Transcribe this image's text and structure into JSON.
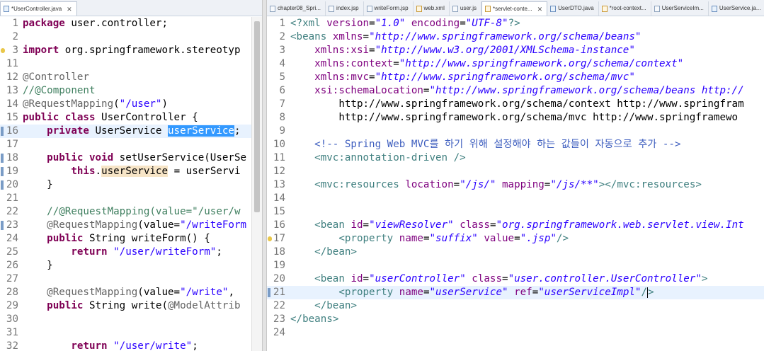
{
  "left_editor": {
    "tab": "*UserController.java",
    "lines": [
      {
        "n": "1",
        "t": "package user.controller;"
      },
      {
        "n": "2",
        "t": ""
      },
      {
        "n": "3",
        "t": "import org.springframework.stereotyp"
      },
      {
        "n": "11",
        "t": ""
      },
      {
        "n": "12",
        "t": "@Controller"
      },
      {
        "n": "13",
        "t": "//@Component"
      },
      {
        "n": "14",
        "t": "@RequestMapping(\"/user\")"
      },
      {
        "n": "15",
        "t": "public class UserController {"
      },
      {
        "n": "16",
        "t": "    private UserService userService;"
      },
      {
        "n": "17",
        "t": ""
      },
      {
        "n": "18",
        "t": "    public void setUserService(UserSe"
      },
      {
        "n": "19",
        "t": "        this.userService = userServi"
      },
      {
        "n": "20",
        "t": "    }"
      },
      {
        "n": "21",
        "t": ""
      },
      {
        "n": "22",
        "t": "    //@RequestMapping(value=\"/user/w"
      },
      {
        "n": "23",
        "t": "    @RequestMapping(value=\"/writeForm"
      },
      {
        "n": "24",
        "t": "    public String writeForm() {"
      },
      {
        "n": "25",
        "t": "        return \"/user/writeForm\";"
      },
      {
        "n": "26",
        "t": "    }"
      },
      {
        "n": "27",
        "t": ""
      },
      {
        "n": "28",
        "t": "    @RequestMapping(value=\"/write\", "
      },
      {
        "n": "29",
        "t": "    public String write(@ModelAttrib"
      },
      {
        "n": "30",
        "t": ""
      },
      {
        "n": "31",
        "t": ""
      },
      {
        "n": "32",
        "t": "        return \"/user/write\";"
      }
    ]
  },
  "right_editor": {
    "tabs": [
      {
        "label": "chapter08_Spri..."
      },
      {
        "label": "index.jsp"
      },
      {
        "label": "writeForm.jsp"
      },
      {
        "label": "web.xml"
      },
      {
        "label": "user.js"
      },
      {
        "label": "*servlet-conte..."
      },
      {
        "label": "UserDTO.java"
      },
      {
        "label": "*root-context..."
      },
      {
        "label": "UserServiceIm..."
      },
      {
        "label": "UserService.ja..."
      }
    ],
    "lines": [
      {
        "n": "1",
        "t": "<?xml version=\"1.0\" encoding=\"UTF-8\"?>"
      },
      {
        "n": "2",
        "t": "<beans xmlns=\"http://www.springframework.org/schema/beans\""
      },
      {
        "n": "3",
        "t": "    xmlns:xsi=\"http://www.w3.org/2001/XMLSchema-instance\""
      },
      {
        "n": "4",
        "t": "    xmlns:context=\"http://www.springframework.org/schema/context\""
      },
      {
        "n": "5",
        "t": "    xmlns:mvc=\"http://www.springframework.org/schema/mvc\""
      },
      {
        "n": "6",
        "t": "    xsi:schemaLocation=\"http://www.springframework.org/schema/beans http://"
      },
      {
        "n": "7",
        "t": "        http://www.springframework.org/schema/context http://www.springfram"
      },
      {
        "n": "8",
        "t": "        http://www.springframework.org/schema/mvc http://www.springframewo"
      },
      {
        "n": "9",
        "t": ""
      },
      {
        "n": "10",
        "t": "    <!-- Spring Web MVC를 하기 위해 설정해야 하는 값들이 자동으로 추가 -->"
      },
      {
        "n": "11",
        "t": "    <mvc:annotation-driven />"
      },
      {
        "n": "12",
        "t": ""
      },
      {
        "n": "13",
        "t": "    <mvc:resources location=\"/js/\" mapping=\"/js/**\"></mvc:resources>"
      },
      {
        "n": "14",
        "t": ""
      },
      {
        "n": "15",
        "t": ""
      },
      {
        "n": "16",
        "t": "    <bean id=\"viewResolver\" class=\"org.springframework.web.servlet.view.Int"
      },
      {
        "n": "17",
        "t": "        <property name=\"suffix\" value=\".jsp\"/>"
      },
      {
        "n": "18",
        "t": "    </bean>"
      },
      {
        "n": "19",
        "t": ""
      },
      {
        "n": "20",
        "t": "    <bean id=\"userController\" class=\"user.controller.UserController\">"
      },
      {
        "n": "21",
        "t": "        <property name=\"userService\" ref=\"userServiceImpl\"/>"
      },
      {
        "n": "22",
        "t": "    </bean>"
      },
      {
        "n": "23",
        "t": "</beans>"
      },
      {
        "n": "24",
        "t": ""
      }
    ]
  }
}
